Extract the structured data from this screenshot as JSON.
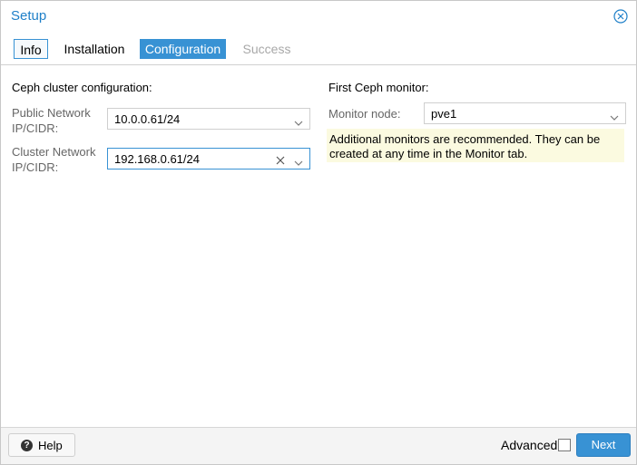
{
  "window": {
    "title": "Setup",
    "close_icon": "close-circle-icon"
  },
  "tabs": [
    {
      "label": "Info",
      "state": "outlined"
    },
    {
      "label": "Installation",
      "state": "normal"
    },
    {
      "label": "Configuration",
      "state": "active"
    },
    {
      "label": "Success",
      "state": "disabled"
    }
  ],
  "left": {
    "section_title": "Ceph cluster configuration:",
    "public_network": {
      "label_line1": "Public Network",
      "label_line2": "IP/CIDR:",
      "value": "10.0.0.61/24"
    },
    "cluster_network": {
      "label_line1": "Cluster Network",
      "label_line2": "IP/CIDR:",
      "value": "192.168.0.61/24"
    }
  },
  "right": {
    "section_title": "First Ceph monitor:",
    "monitor_node": {
      "label": "Monitor node:",
      "value": "pve1"
    },
    "notice_line1": "Additional monitors are recommended. They can be",
    "notice_line2": "created at any time in the Monitor tab."
  },
  "footer": {
    "help_label": "Help",
    "help_icon": "question-circle-icon",
    "advanced_label": "Advanced",
    "advanced_checked": false,
    "next_label": "Next"
  },
  "colors": {
    "accent": "#3892d4",
    "title": "#1e7fc8",
    "notice_bg": "#fbfae0",
    "disabled_text": "#a8a8a8"
  }
}
